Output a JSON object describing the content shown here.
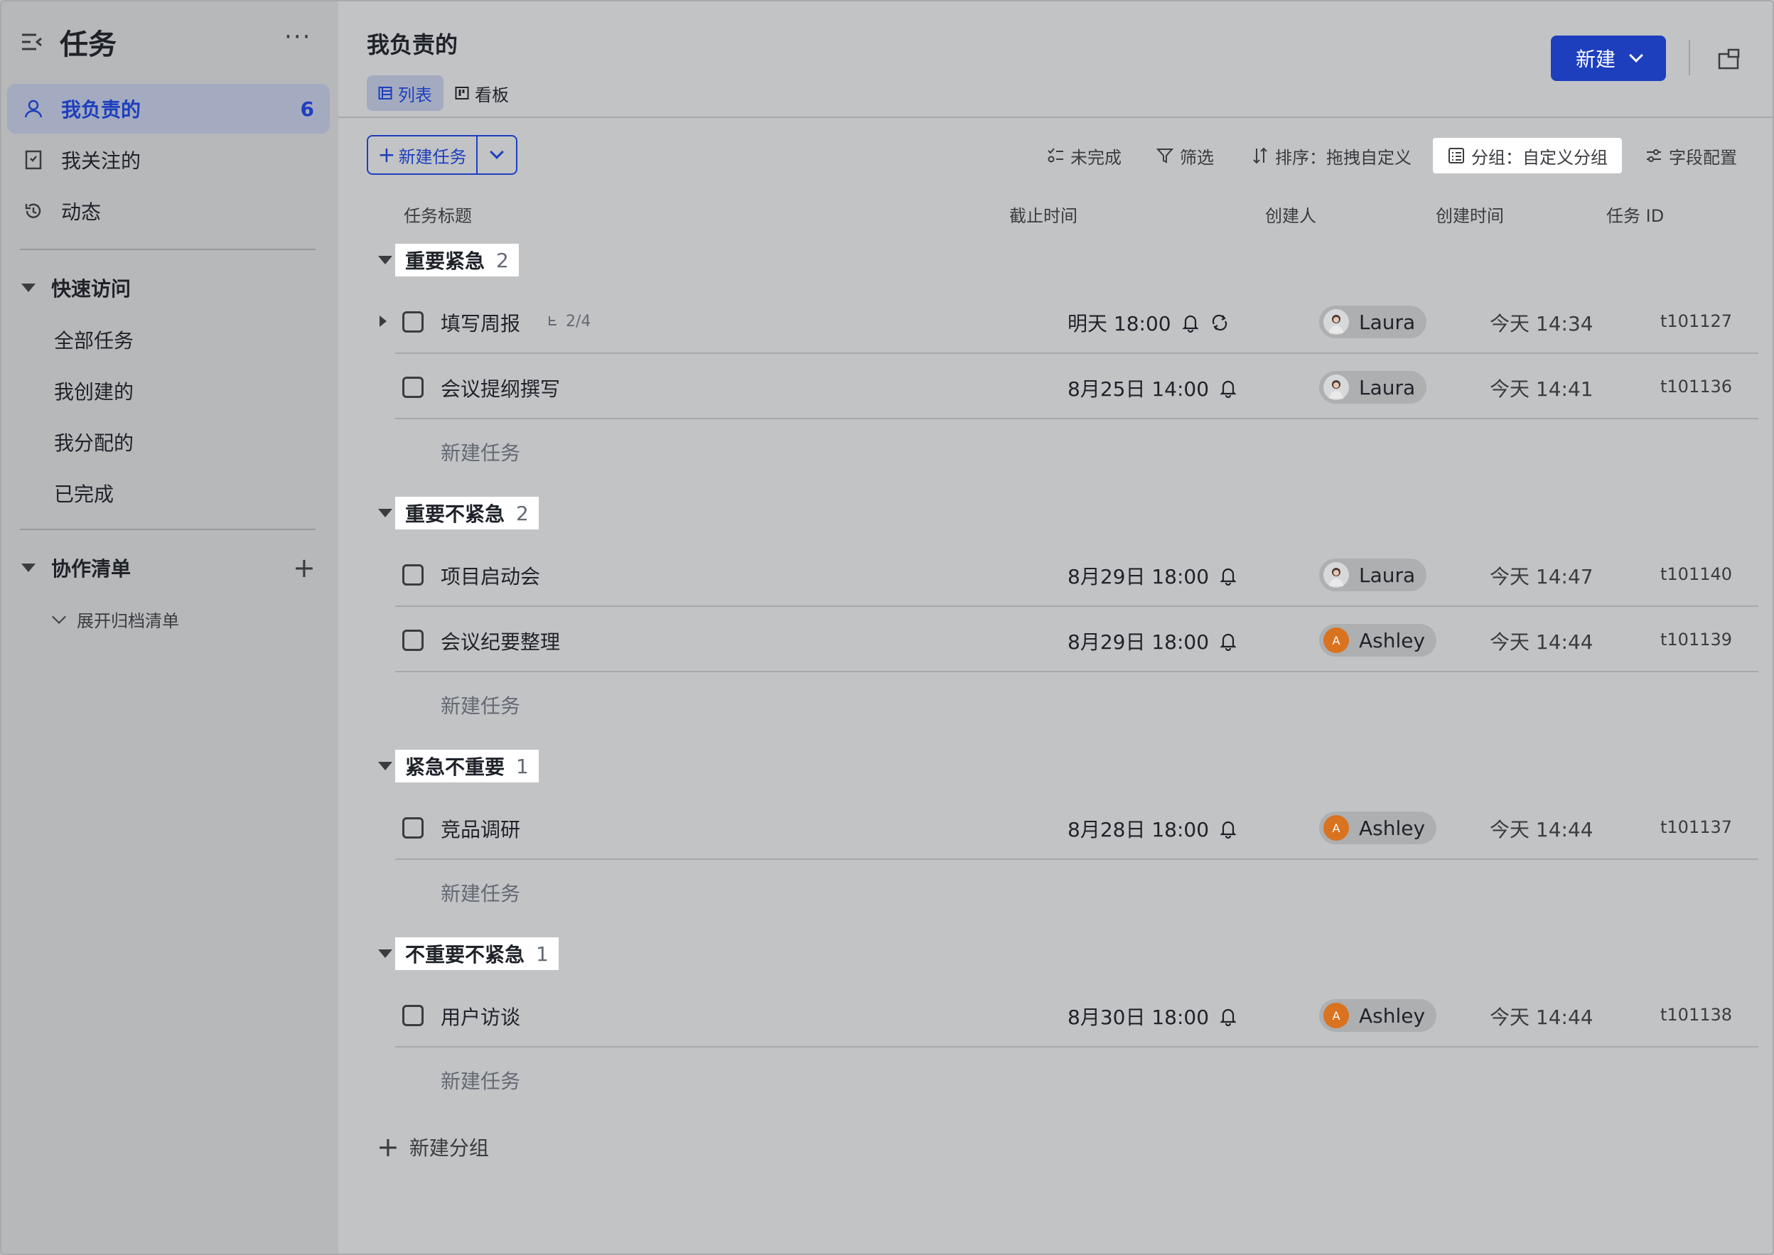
{
  "sidebar": {
    "title": "任务",
    "more": "···",
    "nav": [
      {
        "label": "我负责的",
        "count": "6",
        "icon": "person-icon"
      },
      {
        "label": "我关注的",
        "icon": "bookmark-icon"
      },
      {
        "label": "动态",
        "icon": "history-icon"
      }
    ],
    "quick_access": {
      "title": "快速访问",
      "items": [
        "全部任务",
        "我创建的",
        "我分配的",
        "已完成"
      ]
    },
    "collab": {
      "title": "协作清单",
      "add": "+",
      "archive": "展开归档清单"
    }
  },
  "header": {
    "title": "我负责的",
    "tabs": [
      {
        "label": "列表",
        "icon": "list-icon"
      },
      {
        "label": "看板",
        "icon": "board-icon"
      }
    ],
    "new_button": "新建"
  },
  "toolbar": {
    "new_task": "新建任务",
    "incomplete": "未完成",
    "filter": "筛选",
    "sort": "排序：拖拽自定义",
    "group": "分组：自定义分组",
    "fields": "字段配置"
  },
  "columns": [
    "任务标题",
    "截止时间",
    "创建人",
    "创建时间",
    "任务 ID"
  ],
  "groups": [
    {
      "name": "重要紧急",
      "count": "2",
      "tasks": [
        {
          "title": "填写周报",
          "subtasks": "2/4",
          "due": "明天 18:00",
          "creator": "Laura",
          "created": "今天 14:34",
          "id": "t101127"
        },
        {
          "title": "会议提纲撰写",
          "due": "8月25日 14:00",
          "creator": "Laura",
          "created": "今天 14:41",
          "id": "t101136"
        }
      ]
    },
    {
      "name": "重要不紧急",
      "count": "2",
      "tasks": [
        {
          "title": "项目启动会",
          "due": "8月29日 18:00",
          "creator": "Laura",
          "created": "今天 14:47",
          "id": "t101140"
        },
        {
          "title": "会议纪要整理",
          "due": "8月29日 18:00",
          "creator": "Ashley",
          "avatar_letter": "A",
          "created": "今天 14:44",
          "id": "t101139"
        }
      ]
    },
    {
      "name": "紧急不重要",
      "count": "1",
      "tasks": [
        {
          "title": "竞品调研",
          "due": "8月28日 18:00",
          "creator": "Ashley",
          "avatar_letter": "A",
          "created": "今天 14:44",
          "id": "t101137"
        }
      ]
    },
    {
      "name": "不重要不紧急",
      "count": "1",
      "tasks": [
        {
          "title": "用户访谈",
          "due": "8月30日 18:00",
          "creator": "Ashley",
          "avatar_letter": "A",
          "created": "今天 14:44",
          "id": "t101138"
        }
      ]
    }
  ],
  "new_task_placeholder": "新建任务",
  "new_group": "新建分组",
  "colors": {
    "accent": "#1d3fbd",
    "sidebar_bg": "#b7b8ba",
    "main_bg": "#c2c3c5",
    "ashley_avatar": "#d9731f"
  }
}
